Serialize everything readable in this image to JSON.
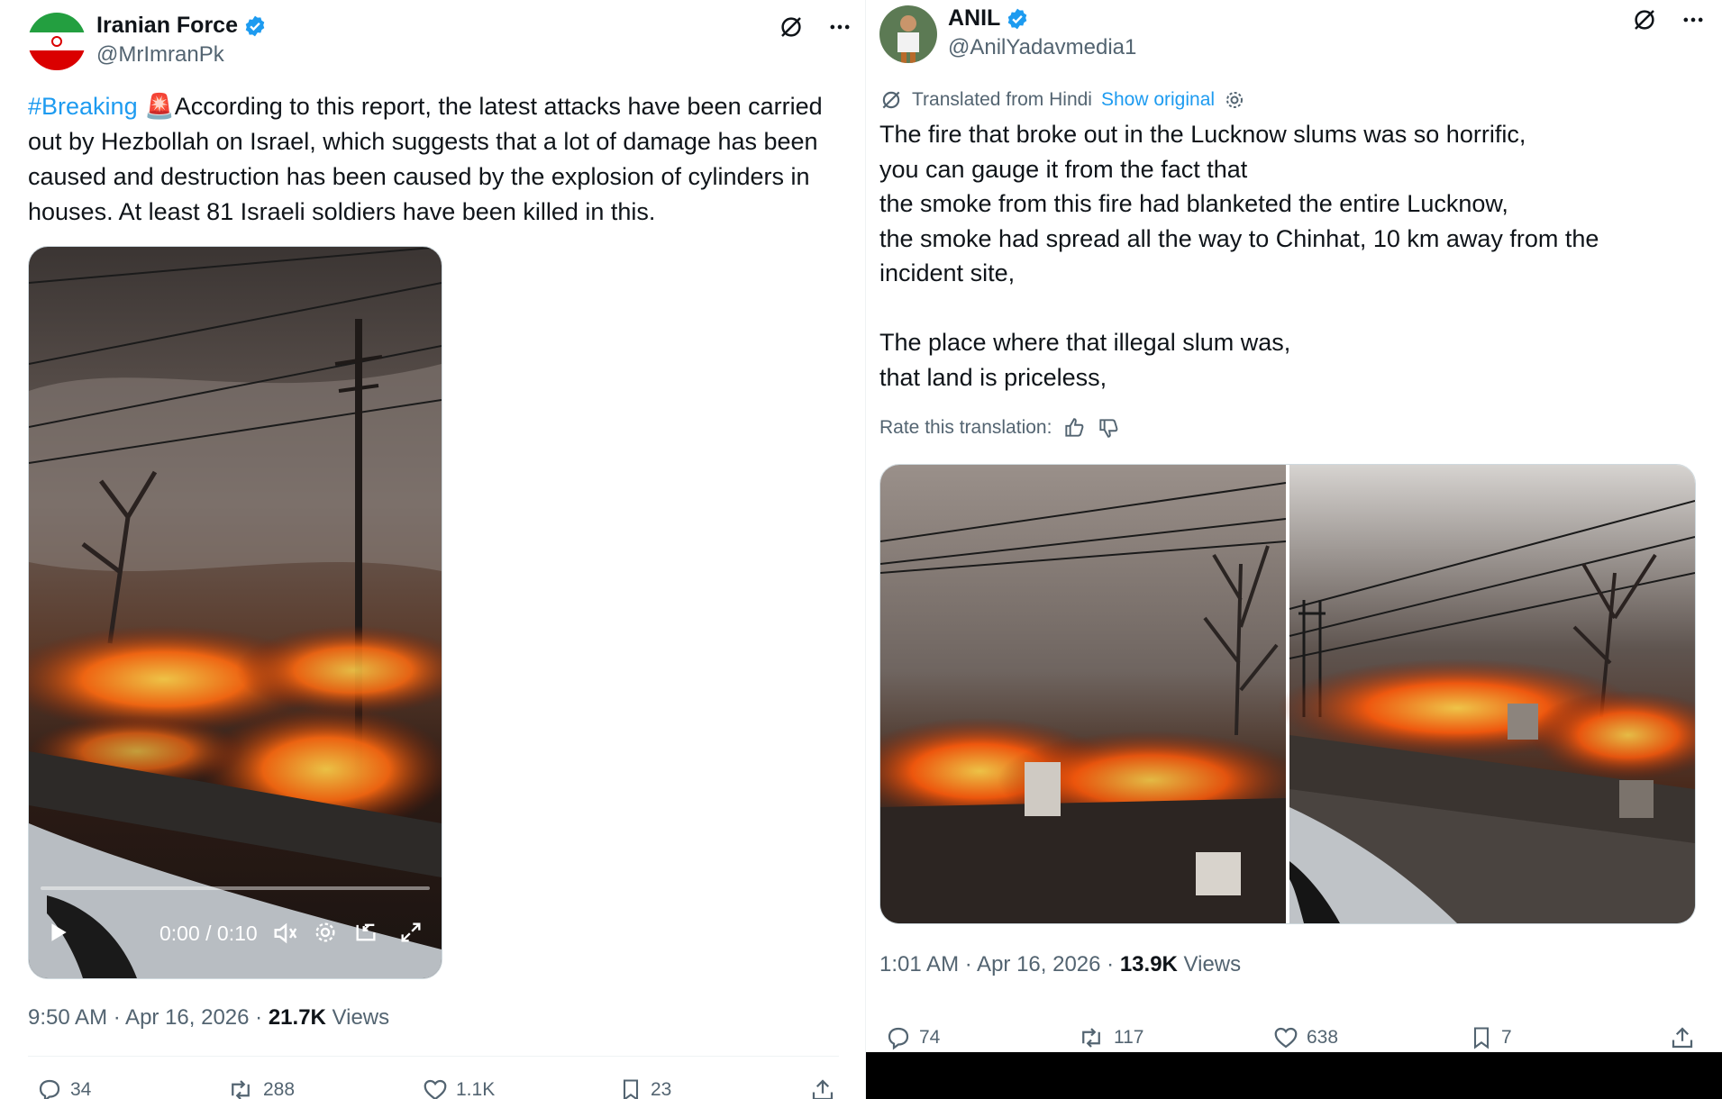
{
  "left": {
    "author_name": "Iranian Force",
    "author_handle": "@MrImranPk",
    "hashtag": "#Breaking",
    "siren_emoji": "🚨",
    "text": "According to this report, the latest attacks have been carried out by Hezbollah on Israel, which suggests that a lot of damage has been caused and destruction has been caused by the explosion of cylinders in houses. At least 81 Israeli soldiers have been killed in this.",
    "video_time": "0:00 / 0:10",
    "video_progress": 0.0,
    "timestamp": "9:50 AM · Apr 16, 2026 · ",
    "views_count": "21.7K",
    "views_label": " Views",
    "replies": "34",
    "reposts": "288",
    "likes": "1.1K",
    "bookmarks": "23"
  },
  "right": {
    "author_name": "ANIL",
    "author_handle": "@AnilYadavmedia1",
    "translated_label": "Translated from Hindi",
    "show_original": "Show original",
    "text": "The fire that broke out in the Lucknow slums was so horrific,\nyou can gauge it from the fact that\nthe smoke from this fire had blanketed the entire Lucknow,\nthe smoke had spread all the way to Chinhat, 10 km away from the\nincident site,\n\nThe place where that illegal slum was,\nthat land is priceless,",
    "rate_label": "Rate this translation:",
    "timestamp": "1:01 AM · Apr 16, 2026 · ",
    "views_count": "13.9K",
    "views_label": " Views",
    "replies": "74",
    "reposts": "117",
    "likes": "638",
    "bookmarks": "7"
  },
  "colors": {
    "accent": "#1d9bf0",
    "text": "#0f1419",
    "muted": "#536471",
    "verified": "#1d9bf0"
  }
}
